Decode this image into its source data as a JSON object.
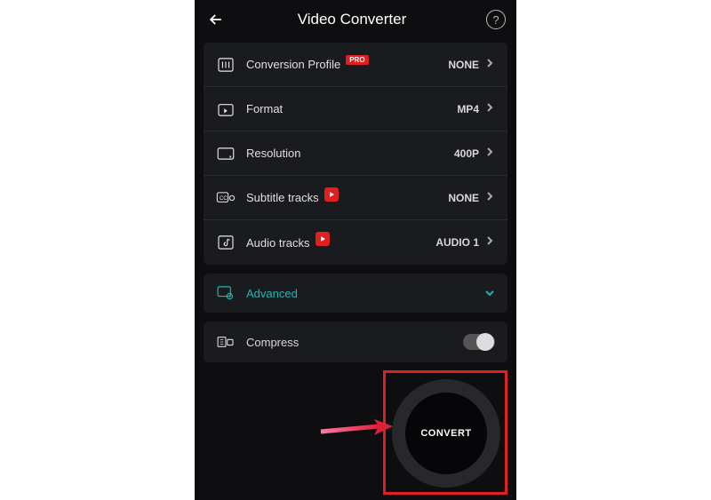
{
  "header": {
    "title": "Video Converter"
  },
  "settings": [
    {
      "label": "Conversion Profile",
      "value": "NONE",
      "badge": "PRO"
    },
    {
      "label": "Format",
      "value": "MP4"
    },
    {
      "label": "Resolution",
      "value": "400P"
    },
    {
      "label": "Subtitle tracks",
      "value": "NONE",
      "play_badge": true
    },
    {
      "label": "Audio tracks",
      "value": "AUDIO 1",
      "play_badge": true
    }
  ],
  "advanced": {
    "label": "Advanced"
  },
  "compress": {
    "label": "Compress",
    "enabled": false
  },
  "convert": {
    "label": "CONVERT"
  },
  "badges": {
    "pro": "PRO"
  }
}
